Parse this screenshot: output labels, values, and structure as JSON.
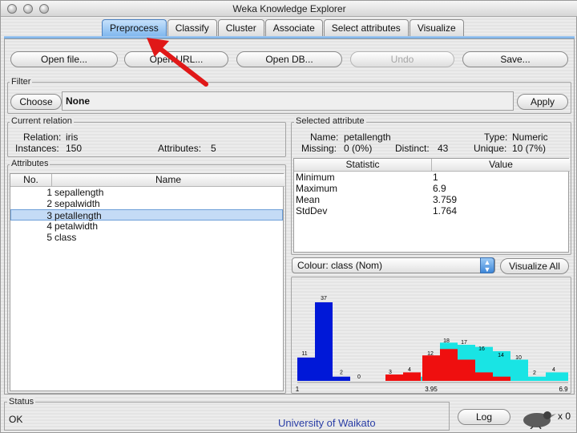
{
  "window": {
    "title": "Weka Knowledge Explorer"
  },
  "tabs": [
    {
      "label": "Preprocess",
      "active": true
    },
    {
      "label": "Classify",
      "active": false
    },
    {
      "label": "Cluster",
      "active": false
    },
    {
      "label": "Associate",
      "active": false
    },
    {
      "label": "Select attributes",
      "active": false
    },
    {
      "label": "Visualize",
      "active": false
    }
  ],
  "toolbar": {
    "open_file": "Open file...",
    "open_url": "Open URL...",
    "open_db": "Open DB...",
    "undo": "Undo",
    "save": "Save..."
  },
  "filter": {
    "group_title": "Filter",
    "choose": "Choose",
    "value": "None",
    "apply": "Apply"
  },
  "current_relation": {
    "group_title": "Current relation",
    "relation_label": "Relation:",
    "relation_value": "iris",
    "instances_label": "Instances:",
    "instances_value": "150",
    "attributes_label": "Attributes:",
    "attributes_value": "5"
  },
  "attributes": {
    "group_title": "Attributes",
    "col_no": "No.",
    "col_name": "Name",
    "rows": [
      {
        "no": "1",
        "name": "sepallength"
      },
      {
        "no": "2",
        "name": "sepalwidth"
      },
      {
        "no": "3",
        "name": "petallength"
      },
      {
        "no": "4",
        "name": "petalwidth"
      },
      {
        "no": "5",
        "name": "class"
      }
    ],
    "selected_index": 2
  },
  "selected_attribute": {
    "group_title": "Selected attribute",
    "name_label": "Name:",
    "name_value": "petallength",
    "type_label": "Type:",
    "type_value": "Numeric",
    "missing_label": "Missing:",
    "missing_value": "0 (0%)",
    "distinct_label": "Distinct:",
    "distinct_value": "43",
    "unique_label": "Unique:",
    "unique_value": "10 (7%)",
    "col_statistic": "Statistic",
    "col_value": "Value",
    "stats": [
      {
        "name": "Minimum",
        "value": "1"
      },
      {
        "name": "Maximum",
        "value": "6.9"
      },
      {
        "name": "Mean",
        "value": "3.759"
      },
      {
        "name": "StdDev",
        "value": "1.764"
      }
    ]
  },
  "colour": {
    "label": "Colour: class (Nom)",
    "visualize_all": "Visualize All"
  },
  "histogram": {
    "x_min_label": "1",
    "x_mid_label": "3.95",
    "x_max_label": "6.9",
    "colors": {
      "blue": "#0018d8",
      "red": "#ef0f0f",
      "cyan": "#19e4e4"
    },
    "blue_bars": [
      {
        "value": 11,
        "label": "11"
      },
      {
        "value": 37,
        "label": "37"
      },
      {
        "value": 2,
        "label": "2"
      },
      {
        "value": 0,
        "label": "0"
      }
    ],
    "right_labels": [
      "3",
      "4",
      "12",
      "18",
      "17",
      "16",
      "14",
      "10",
      "2",
      "4"
    ]
  },
  "status": {
    "group_title": "Status",
    "text": "OK",
    "log": "Log",
    "x0": "x 0"
  },
  "footer": {
    "credit": "University of Waikato",
    "credit_color": "#2a3ea6"
  },
  "annotation": {
    "arrow_color": "#e01818"
  }
}
